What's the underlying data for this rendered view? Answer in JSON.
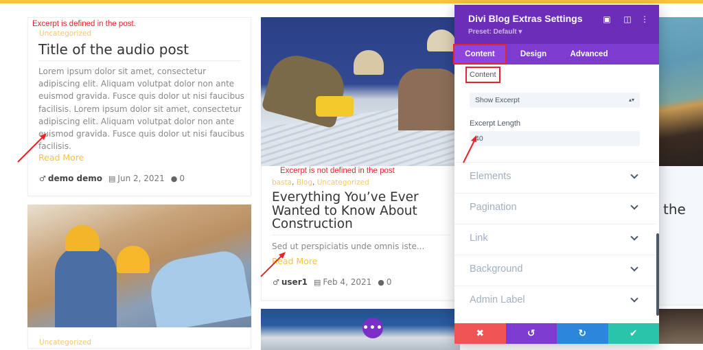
{
  "colors": {
    "accent_yellow": "#f9c33d",
    "panel_purple": "#6c2eb9",
    "annotation_red": "#e8232a",
    "cancel_red": "#ef5555",
    "undo_purple": "#7e3bd0",
    "redo_blue": "#2b87da",
    "save_teal": "#29c4a9"
  },
  "annotations": {
    "defined": "Excerpt is defined in the post.",
    "not_defined": "Excerpt is not defined in the post"
  },
  "posts": [
    {
      "category": "Uncategorized",
      "title": "Title of the audio post",
      "excerpt": "Lorem ipsum dolor sit amet, consectetur adipiscing elit. Aliquam volutpat dolor non ante euismod gravida. Fusce quis dolor ut nisi faucibus facilisis. Lorem ipsum dolor sit amet, consectetur adipiscing elit. Aliquam volutpat dolor non ante euismod gravida. Fusce quis dolor ut nisi faucibus facilisis.",
      "read_more": "Read More",
      "author": "demo demo",
      "date": "Jun 2, 2021",
      "comments": "0"
    },
    {
      "categories": [
        "basta",
        "Blog",
        "Uncategorized"
      ],
      "category_sep": ", ",
      "title": "Everything You’ve Ever Wanted to Know About Construction",
      "excerpt": "Sed ut perspiciatis unde omnis iste...",
      "read_more": "Read More",
      "author": "user1",
      "date": "Feb 4, 2021",
      "comments": "0"
    },
    {
      "category": "Uncategorized"
    }
  ],
  "partial_title_right": "the",
  "more_button": "•••",
  "settings": {
    "title": "Divi Blog Extras Settings",
    "preset": "Preset: Default ▾",
    "tabs": [
      "Content",
      "Design",
      "Advanced"
    ],
    "active_tab": "Content",
    "content_label": "Content",
    "content_select": "Show Excerpt",
    "excerpt_length_label": "Excerpt Length",
    "excerpt_length_value": "40",
    "sections": [
      "Elements",
      "Pagination",
      "Link",
      "Background",
      "Admin Label"
    ],
    "footer": {
      "cancel": "✖",
      "undo": "↺",
      "redo": "↻",
      "save": "✔"
    }
  },
  "icons": {
    "author": "♂",
    "calendar": "▤",
    "comment": "●",
    "expand": "▣",
    "sidebar": "◫",
    "menu": "⋮",
    "select_caret": "▴▾"
  }
}
